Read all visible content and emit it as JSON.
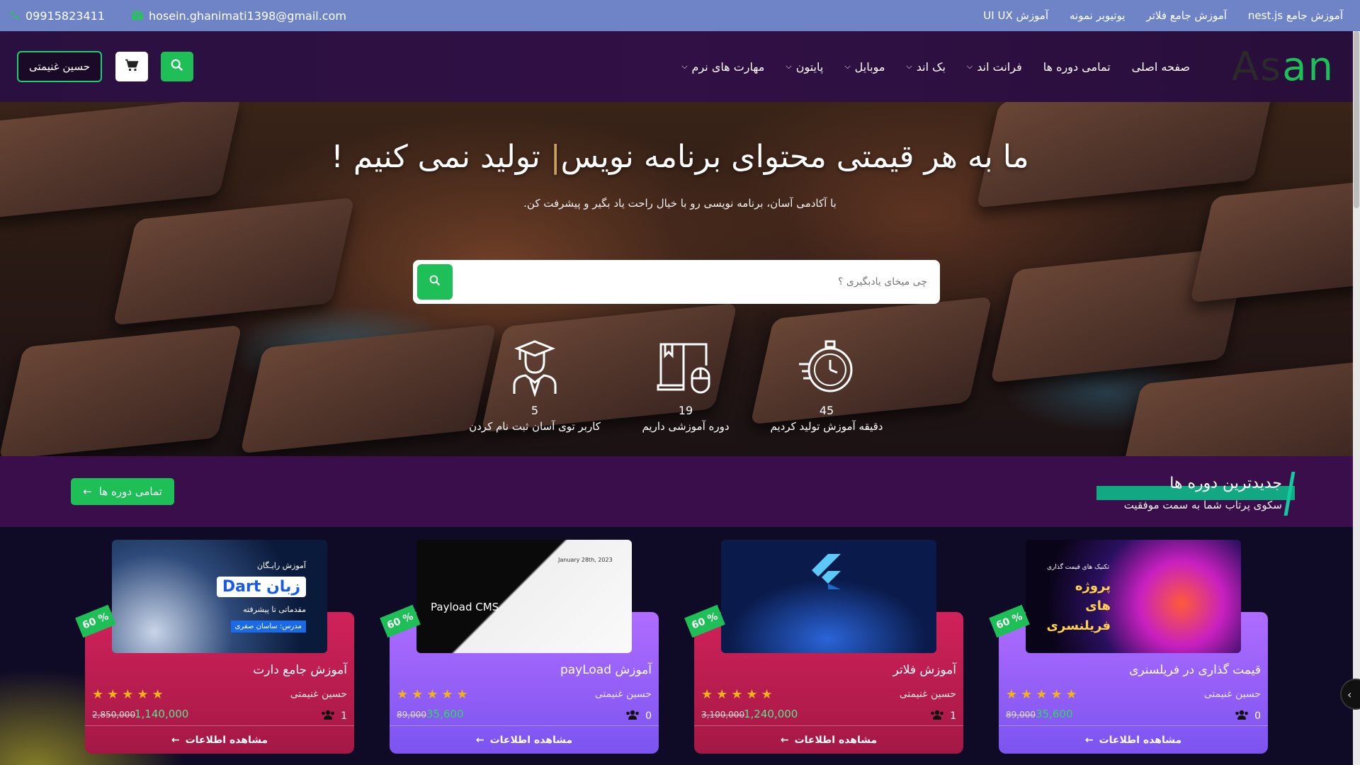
{
  "topbar": {
    "phone": "09915823411",
    "email": "hosein.ghanimati1398@gmail.com",
    "links": [
      "آموزش جامع nest.js",
      "آموزش جامع فلاتر",
      "یوتیوبر نمونه",
      "آموزش UI UX"
    ]
  },
  "header": {
    "logo": "Asan",
    "user_button": "حسین غنیمتی",
    "nav": [
      {
        "label": "صفحه اصلی",
        "has_caret": false
      },
      {
        "label": "تمامی دوره ها",
        "has_caret": false
      },
      {
        "label": "فرانت اند",
        "has_caret": true
      },
      {
        "label": "بک اند",
        "has_caret": true
      },
      {
        "label": "موبایل",
        "has_caret": true
      },
      {
        "label": "پایتون",
        "has_caret": true
      },
      {
        "label": "مهارت های نرم",
        "has_caret": true
      }
    ]
  },
  "hero": {
    "title_part1": "ما به هر قیمتی محتوای برنامه نویس",
    "title_cursor": "|",
    "title_part2": " تولید نمی کنیم !",
    "subtitle": "با آکادمی آسان، برنامه نویسی رو با خیال راحت یاد بگیر و پیشرفت کن.",
    "search_placeholder": "چی میخای یادبگیری ؟",
    "stats": [
      {
        "value": "45",
        "label": "دقیقه آموزش تولید کردیم",
        "icon": "stopwatch-icon"
      },
      {
        "value": "19",
        "label": "دوره آموزشی داریم",
        "icon": "book-mouse-icon"
      },
      {
        "value": "5",
        "label": "کاربر توی آسان ثبت نام کردن",
        "icon": "graduate-icon"
      }
    ]
  },
  "section": {
    "title": "جدیدترین دوره ها",
    "subtitle": "سکوی پرتاب شما به سمت موفقیت",
    "all_button": "تمامی دوره ها"
  },
  "courses": [
    {
      "title": "آموزش جامع دارت",
      "teacher": "حسین غنیمتی",
      "old_price": "2,850,000",
      "new_price": "1,140,000",
      "students": "1",
      "discount": "60 %",
      "theme": "red",
      "thumb_class": "thumb-dart",
      "thumb_text_1": "آموزش رایـگان",
      "thumb_text_2": "زبان Dart",
      "thumb_text_3": "مقدماتی تا پیشرفته",
      "thumb_text_4": "مدرس: ساسان صفری"
    },
    {
      "title": "آموزش payLoad",
      "teacher": "حسین غنیمتی",
      "old_price": "89,000",
      "new_price": "35,600",
      "students": "0",
      "discount": "60 %",
      "theme": "purple",
      "thumb_class": "thumb-payload",
      "thumb_text_1": "Payload CMS",
      "thumb_text_2": "January 28th, 2023"
    },
    {
      "title": "آموزش فلاتر",
      "teacher": "حسین غنیمتی",
      "old_price": "3,100,000",
      "new_price": "1,240,000",
      "students": "1",
      "discount": "60 %",
      "theme": "red",
      "thumb_class": "thumb-flutter"
    },
    {
      "title": "قیمت گذاری در فریلسنری",
      "teacher": "حسین غنیمتی",
      "old_price": "89,000",
      "new_price": "35,600",
      "students": "0",
      "discount": "60 %",
      "theme": "purple",
      "thumb_class": "thumb-freelance",
      "thumb_text_1": "تکنیک های قیمت گذاری",
      "thumb_text_2": "پروژه های فریلنسری"
    }
  ],
  "card_button": "مشاهده اطلاعات",
  "colors": {
    "accent": "#1fbf58",
    "topbar": "#6f84c7",
    "card_red": "#c21f52",
    "card_purple": "#9a5ff8"
  }
}
